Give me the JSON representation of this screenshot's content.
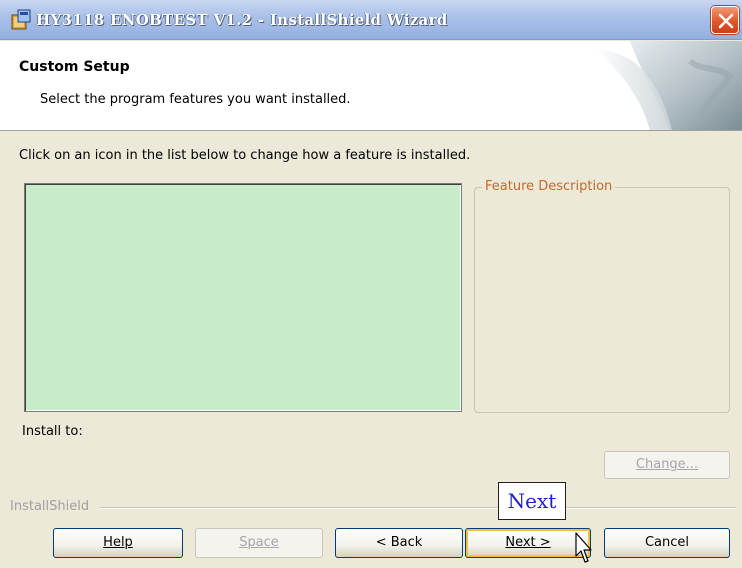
{
  "window": {
    "title": "HY3118 ENOBTEST V1.2 - InstallShield Wizard",
    "close_icon": "close-icon"
  },
  "header": {
    "title": "Custom Setup",
    "subtitle": "Select the program features you want installed."
  },
  "main": {
    "instruction": "Click on an icon in the list below to change how a feature is installed.",
    "feature_description_label": "Feature Description",
    "install_to_label": "Install to:",
    "change_label": "Change..."
  },
  "footer": {
    "brand": "InstallShield",
    "annotation": "Next",
    "help_label": "Help",
    "space_label": "Space",
    "back_label": "< Back",
    "next_label": "Next >",
    "cancel_label": "Cancel"
  },
  "colors": {
    "dialog_bg": "#ECE9D8",
    "feature_tree_bg": "#C8EBC9",
    "group_label": "#C46A2A",
    "disabled_text": "#A7A6AA",
    "close_button": "#E0562C"
  }
}
